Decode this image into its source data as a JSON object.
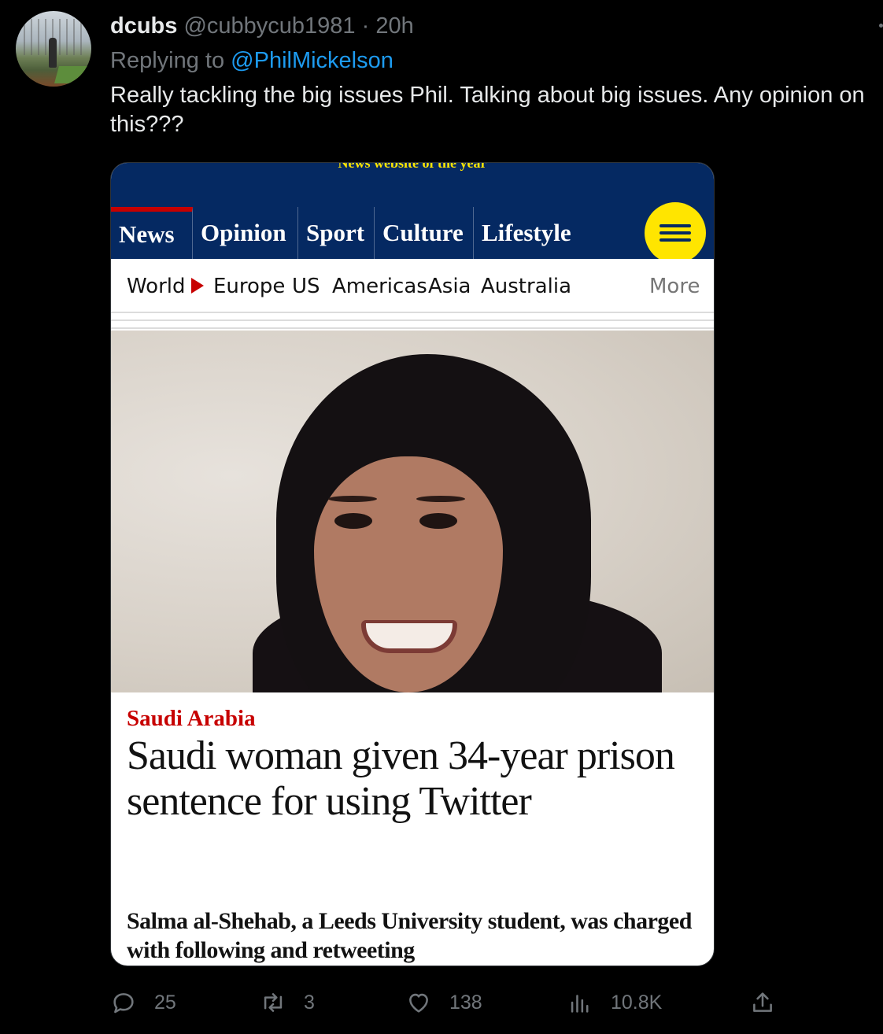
{
  "tweet": {
    "display_name": "dcubs",
    "handle": "@cubbycub1981",
    "separator": "·",
    "time": "20h",
    "reply_prefix": "Replying to",
    "reply_to": "@PhilMickelson",
    "text": "Really tackling the big issues Phil. Talking about big issues. Any opinion on this???"
  },
  "article": {
    "award_banner": "News website of the year",
    "pillars": [
      "News",
      "Opinion",
      "Sport",
      "Culture",
      "Lifestyle"
    ],
    "subnav": [
      "World",
      "Europe",
      "US",
      "Americas",
      "Asia",
      "Australia"
    ],
    "more_label": "More",
    "info_label": "i",
    "kicker": "Saudi Arabia",
    "headline": "Saudi woman given 34-year prison sentence for using Twitter",
    "standfirst": "Salma al-Shehab, a Leeds University student, was charged with following and retweeting",
    "colors": {
      "nav_blue": "#052962",
      "accent_red": "#c70000",
      "menu_yellow": "#ffe500"
    }
  },
  "actions": {
    "replies": "25",
    "retweets": "3",
    "likes": "138",
    "views": "10.8K",
    "icons": [
      "reply-icon",
      "retweet-icon",
      "like-icon",
      "views-icon",
      "share-icon"
    ]
  }
}
